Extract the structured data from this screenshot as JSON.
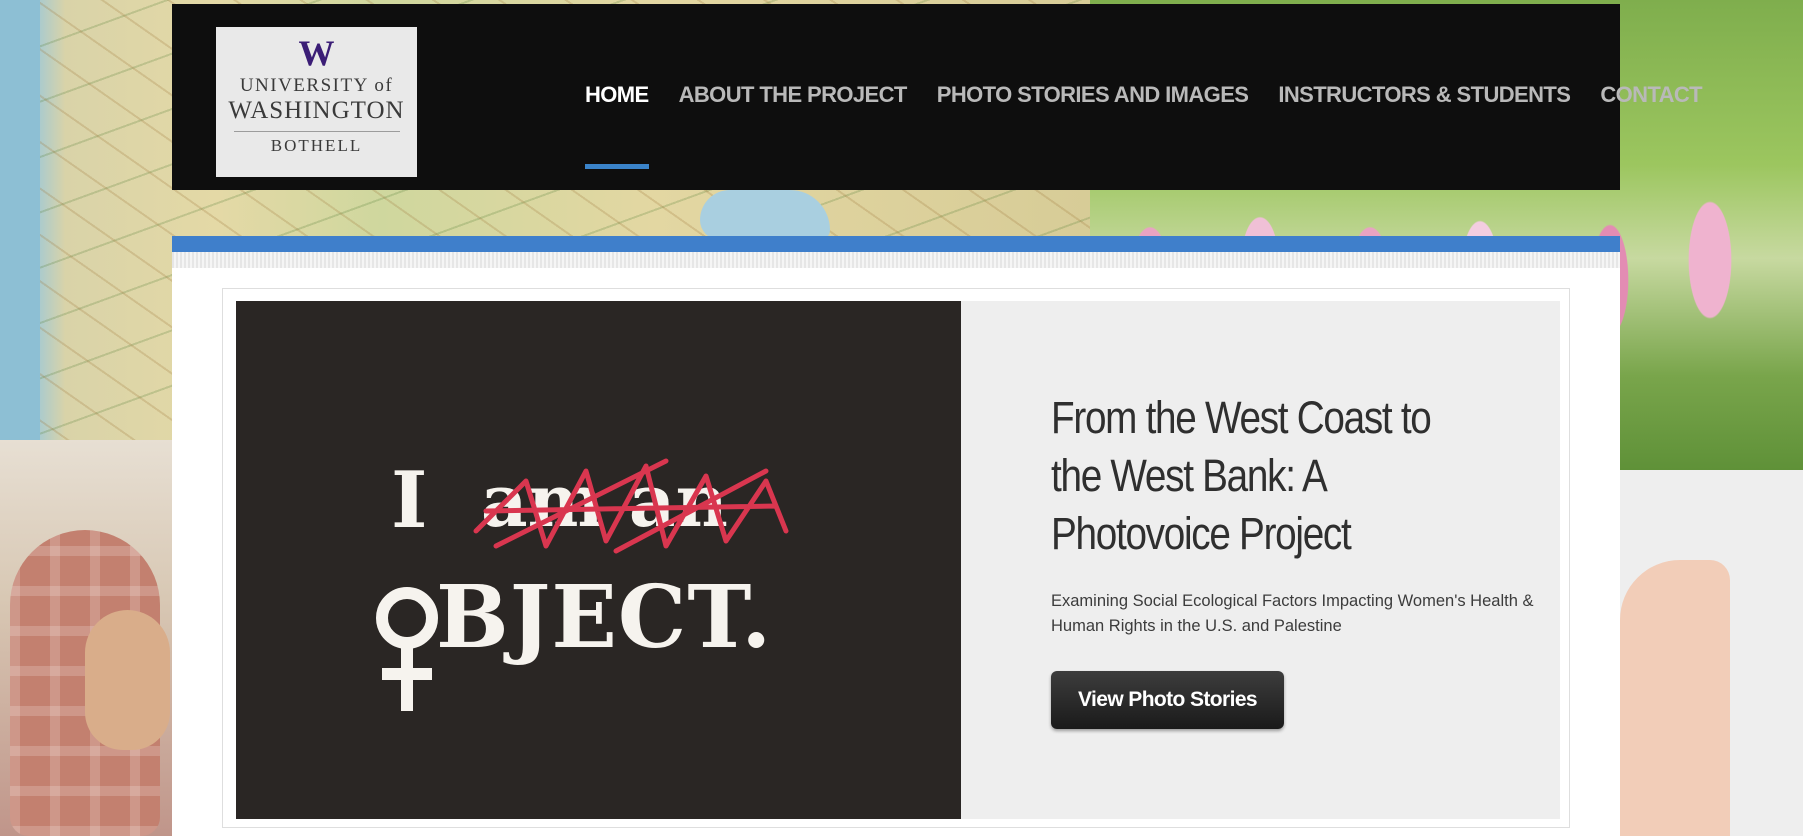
{
  "header": {
    "logo": {
      "mark": "W",
      "line1": "UNIVERSITY of",
      "line2": "WASHINGTON",
      "line3": "BOTHELL"
    },
    "nav": [
      {
        "label": "HOME",
        "active": true
      },
      {
        "label": "ABOUT THE PROJECT",
        "active": false
      },
      {
        "label": "PHOTO STORIES AND IMAGES",
        "active": false
      },
      {
        "label": "INSTRUCTORS & STUDENTS",
        "active": false
      },
      {
        "label": "CONTACT",
        "active": false
      }
    ]
  },
  "slide": {
    "poster": {
      "word_i": "I",
      "struck_text": "am an",
      "object_text": "BJECT."
    },
    "title": "From the West Coast to the West Bank: A Photovoice Project",
    "description": "Examining Social Ecological Factors Impacting Women's Health & Human Rights in the U.S. and Palestine",
    "button_label": "View Photo Stories"
  },
  "colors": {
    "accent": "#3a83c9",
    "header_bg": "#0e0e0e",
    "nav_active": "#ffffff",
    "nav_inactive": "#b9b9b9",
    "uw_purple": "#3b1d76",
    "scribble_red": "#d9364f"
  }
}
